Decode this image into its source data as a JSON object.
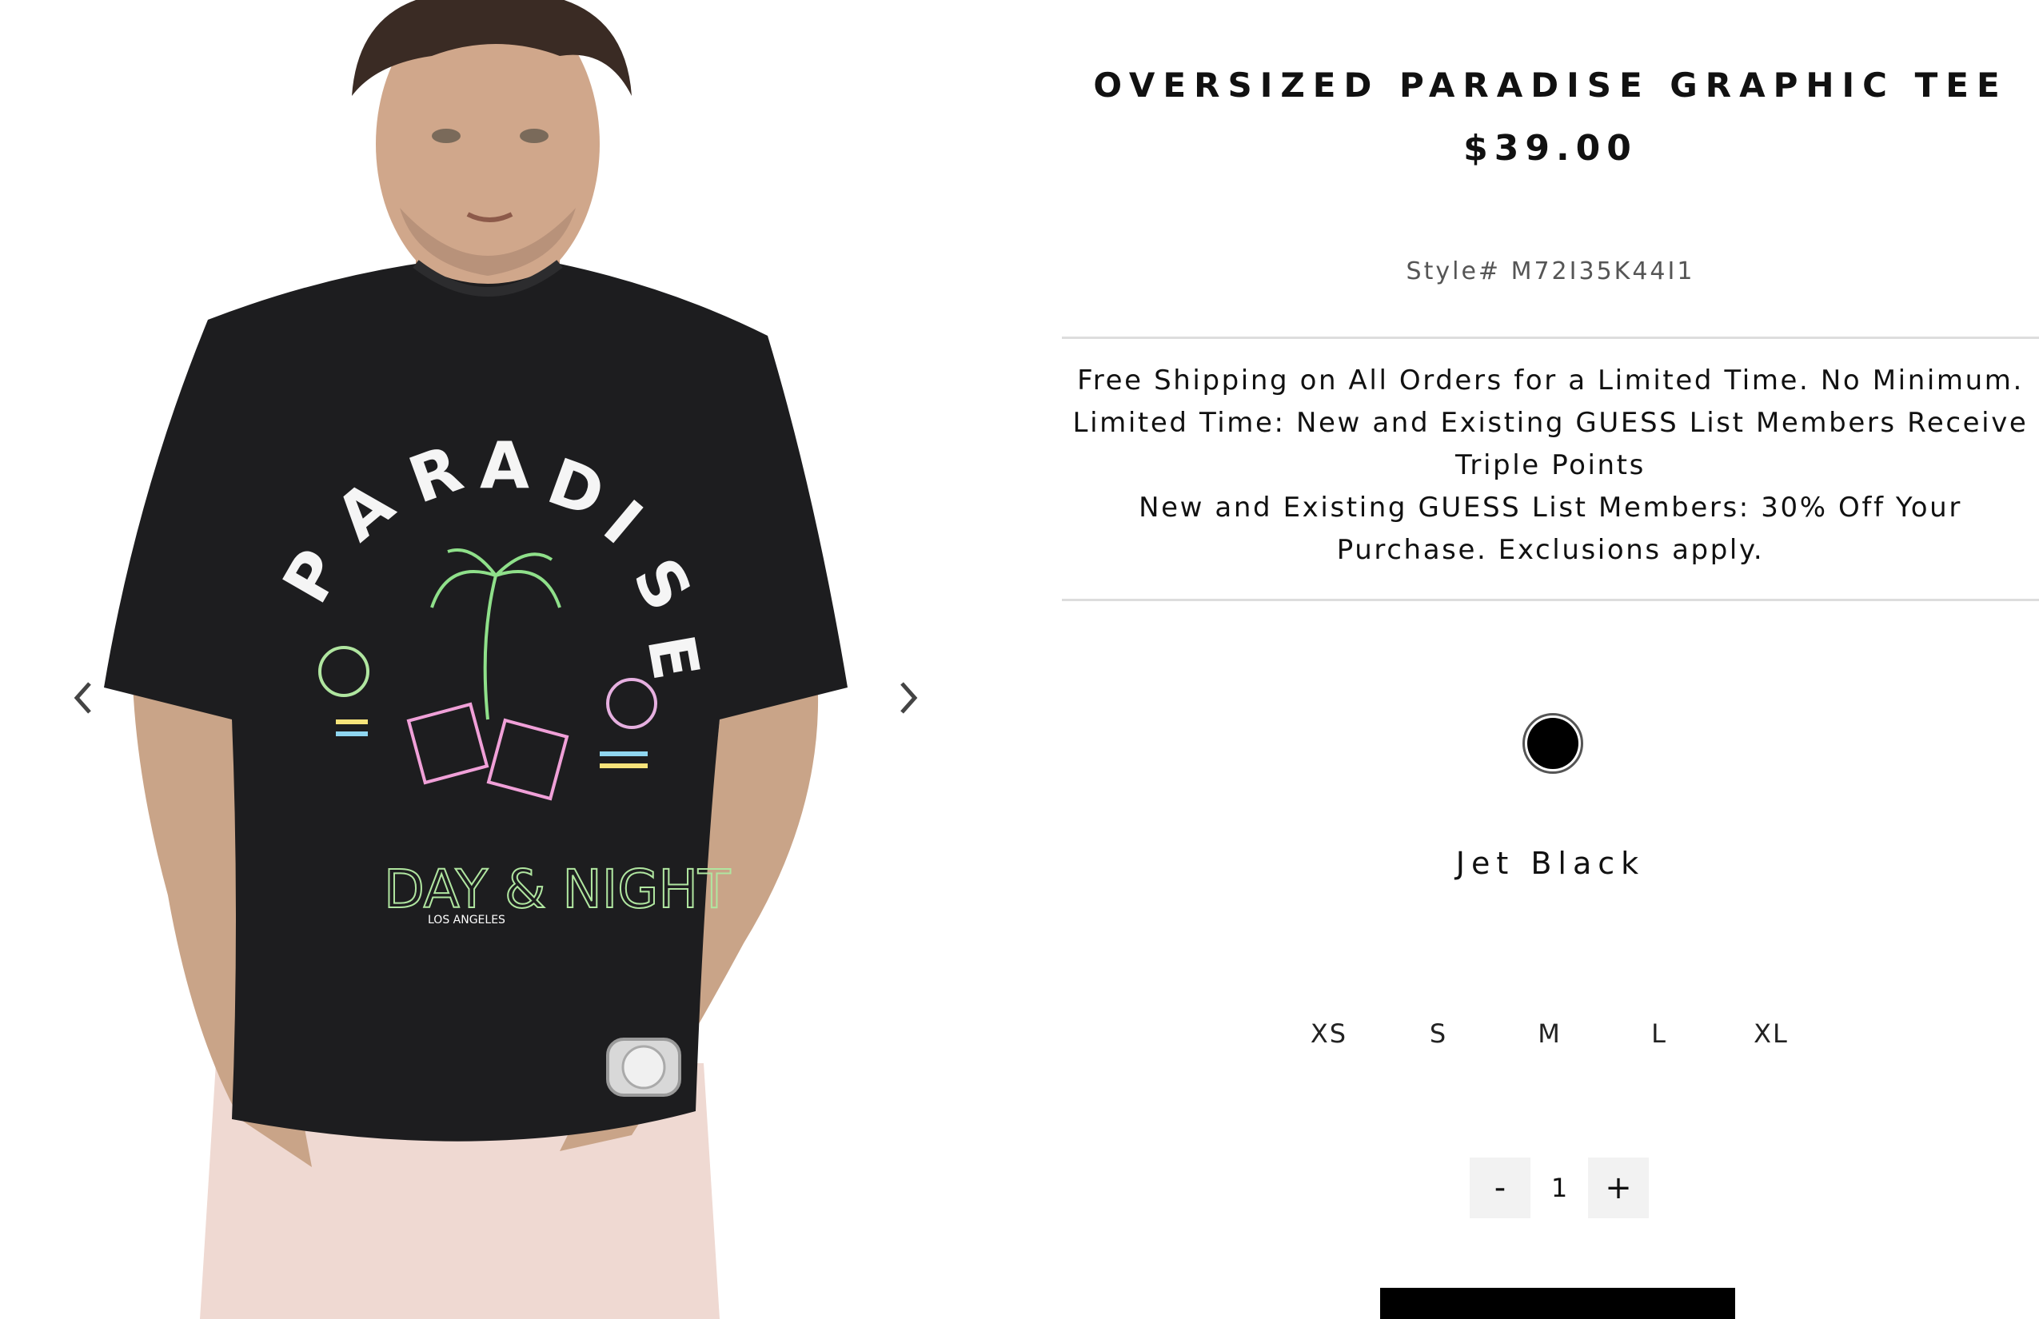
{
  "product": {
    "title": "OVERSIZED PARADISE GRAPHIC TEE",
    "price": "$39.00",
    "style_number": "Style# M72I35K44I1",
    "image_icon": "product-photo-model-black-tee"
  },
  "gallery": {
    "prev_icon": "chevron-left-icon",
    "next_icon": "chevron-right-icon"
  },
  "promos": [
    "Free Shipping on All Orders for a Limited Time. No Minimum.",
    "Limited Time: New and Existing GUESS List Members Receive",
    "Triple Points",
    "New and Existing GUESS List Members: 30% Off Your",
    "Purchase. Exclusions apply."
  ],
  "color": {
    "selected_name": "Jet Black",
    "swatch_hex": "#000000"
  },
  "sizes": [
    "XS",
    "S",
    "M",
    "L",
    "XL"
  ],
  "quantity": {
    "minus_label": "-",
    "value": "1",
    "plus_label": "+"
  },
  "colors": {
    "text": "#111111",
    "muted": "#555555",
    "divider": "#dddddd",
    "button_bg": "#000000",
    "qty_bg": "#f2f2f2"
  }
}
